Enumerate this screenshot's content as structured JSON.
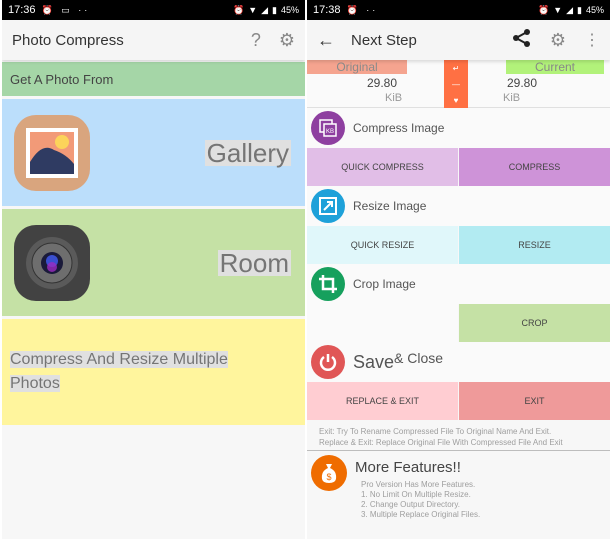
{
  "left_screen": {
    "status": {
      "time": "17:36",
      "battery": "45%"
    },
    "appbar": {
      "title": "Photo Compress",
      "help_icon": "question-icon",
      "settings_icon": "gear-icon"
    },
    "get_from_label": "Get A Photo From",
    "sources": [
      {
        "label": "Gallery",
        "icon": "gallery-icon"
      },
      {
        "label": "Room",
        "icon": "camera-icon"
      }
    ],
    "multiple": {
      "line1": "Compress And Resize Multiple",
      "line2": "Photos"
    }
  },
  "right_screen": {
    "status": {
      "time": "17:38",
      "battery": "45%"
    },
    "appbar": {
      "title": "Next Step",
      "back_icon": "arrow-left-icon",
      "share_icon": "share-icon",
      "settings_icon": "gear-icon",
      "more_icon": "more-vert-icon"
    },
    "sizes": {
      "original_label": "Original",
      "original_value": "29.80",
      "original_unit": "KiB",
      "current_label": "Current",
      "current_value": "29.80",
      "current_unit": "KiB"
    },
    "compress": {
      "title": "Compress Image",
      "quick_label": "QUICK COMPRESS",
      "main_label": "COMPRESS"
    },
    "resize": {
      "title": "Resize Image",
      "quick_label": "QUICK RESIZE",
      "main_label": "RESIZE"
    },
    "crop": {
      "title": "Crop Image",
      "main_label": "CROP"
    },
    "save": {
      "title_big": "Save",
      "title_small": "& Close",
      "replace_label": "REPLACE & EXIT",
      "exit_label": "EXIT"
    },
    "notes": {
      "exit": "Exit: Try To Rename Compressed File To Original Name And Exit.",
      "replace": "Replace & Exit: Replace Original File With Compressed File And Exit"
    },
    "more": {
      "title": "More Features!!",
      "items": [
        "Pro Version Has More Features.",
        "1. No Limit On Multiple Resize.",
        "2. Change Output Directory.",
        "3. Multiple Replace Original Files."
      ]
    }
  },
  "colors": {
    "get_from_bg": "#a5d6a7",
    "gallery_bg": "#bbdefb",
    "camera_bg": "#c5e1a5",
    "multiple_bg": "#fff59d",
    "compress_quick": "#e1bee7",
    "compress_main": "#ce93d8",
    "resize_quick": "#e0f7fa",
    "resize_main": "#b2ebf2",
    "crop_main": "#c5e1a5",
    "replace_exit": "#ffcdd2",
    "exit": "#ef9a9a"
  }
}
